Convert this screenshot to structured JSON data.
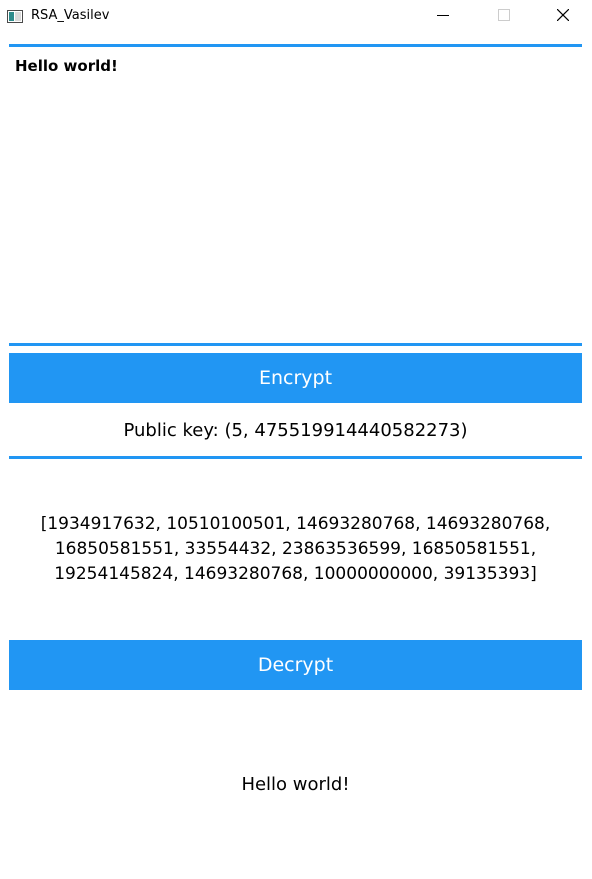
{
  "window": {
    "title": "RSA_Vasilev",
    "icons": {
      "app": "app-window-icon",
      "minimize": "minimize-icon",
      "maximize": "maximize-icon",
      "close": "close-icon"
    }
  },
  "input": {
    "value": "Hello world!"
  },
  "encrypt_button": {
    "label": "Encrypt"
  },
  "public_key": {
    "text": "Public key: (5, 475519914440582273)"
  },
  "ciphertext": {
    "lines": [
      "[1934917632, 10510100501, 14693280768, 14693280768,",
      "16850581551, 33554432, 23863536599, 16850581551,",
      "19254145824, 14693280768, 10000000000, 39135393]"
    ]
  },
  "decrypt_button": {
    "label": "Decrypt"
  },
  "decrypted": {
    "text": "Hello world!"
  },
  "colors": {
    "accent": "#2196F3",
    "button_text": "#FFFFFF"
  }
}
